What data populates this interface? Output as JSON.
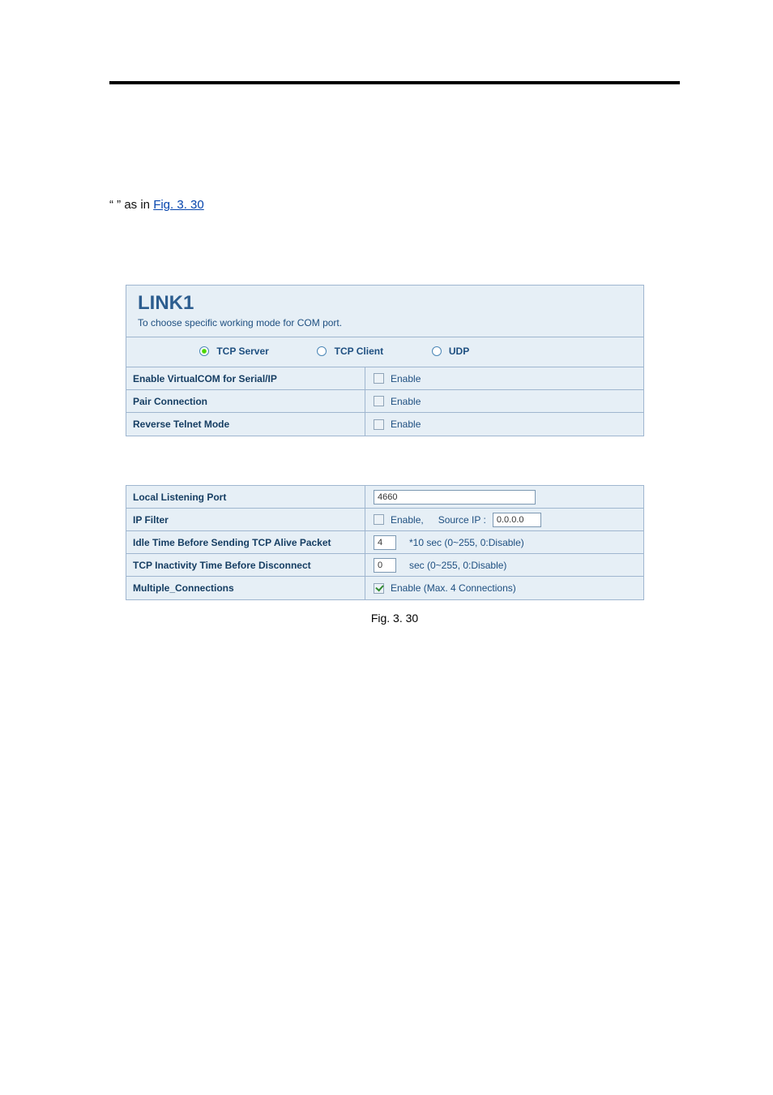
{
  "intro": {
    "prefix_quote": "“",
    "quoted_text": "",
    "suffix_quote": "” as in ",
    "fig_ref": "Fig. 3. 30"
  },
  "caption": "Fig. 3. 30",
  "panel": {
    "title": "LINK1",
    "subtitle": "To choose specific working mode for COM port.",
    "modes": {
      "tcp_server": "TCP Server",
      "tcp_client": "TCP Client",
      "udp": "UDP",
      "selected": "tcp_server"
    },
    "rows_top": [
      {
        "label": "Enable VirtualCOM for Serial/IP",
        "enable_text": "Enable",
        "checked": false
      },
      {
        "label": "Pair Connection",
        "enable_text": "Enable",
        "checked": false
      },
      {
        "label": "Reverse Telnet Mode",
        "enable_text": "Enable",
        "checked": false
      }
    ],
    "rows_bottom": {
      "local_port": {
        "label": "Local Listening Port",
        "value": "4660"
      },
      "ip_filter": {
        "label": "IP Filter",
        "enable_text": "Enable,",
        "source_label": "Source IP :",
        "source_ip": "0.0.0.0",
        "checked": false
      },
      "idle_alive": {
        "label": "Idle Time Before Sending TCP Alive Packet",
        "value": "4",
        "unit_text": "*10 sec (0~255, 0:Disable)"
      },
      "inactivity": {
        "label": "TCP Inactivity Time Before Disconnect",
        "value": "0",
        "unit_text": "sec (0~255, 0:Disable)"
      },
      "multi_conn": {
        "label": "Multiple_Connections",
        "text": "Enable (Max. 4 Connections)",
        "checked": true
      }
    }
  }
}
